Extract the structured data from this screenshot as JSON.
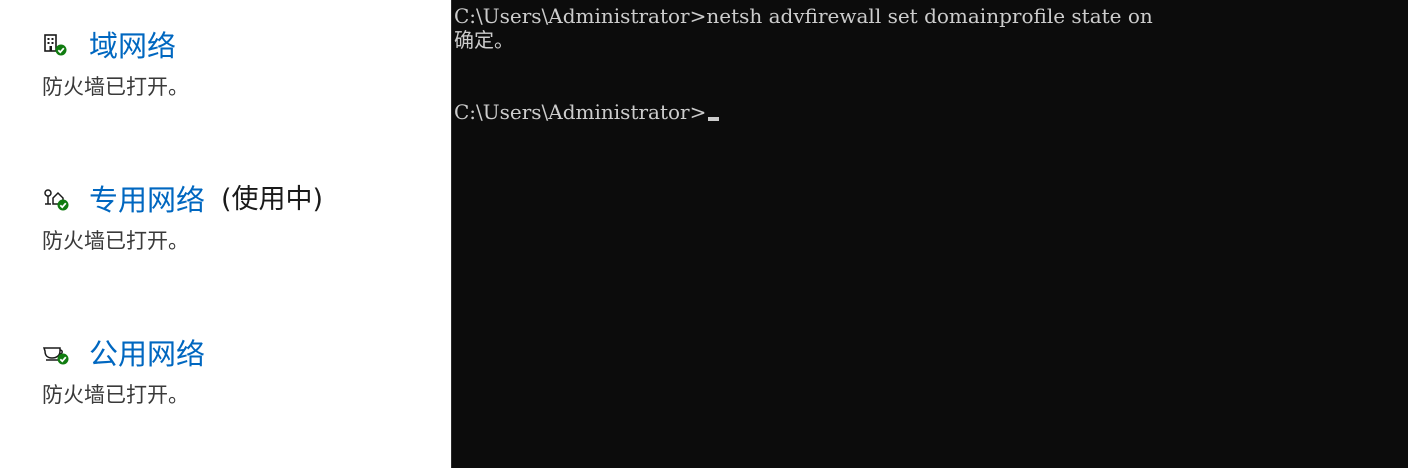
{
  "firewall": {
    "networks": [
      {
        "name": "域网络",
        "icon": "domain-network-icon",
        "status": "防火墙已打开。",
        "in_use": ""
      },
      {
        "name": "专用网络",
        "icon": "private-network-icon",
        "status": "防火墙已打开。",
        "in_use": "(使用中)"
      },
      {
        "name": "公用网络",
        "icon": "public-network-icon",
        "status": "防火墙已打开。",
        "in_use": ""
      }
    ],
    "colors": {
      "link": "#0067c0",
      "status_check": "#107c10"
    }
  },
  "console": {
    "lines": [
      "C:\\Users\\Administrator>netsh advfirewall set domainprofile state on",
      "确定。",
      "",
      "C:\\Users\\Administrator>"
    ],
    "colors": {
      "background": "#0c0c0c",
      "text": "#cccccc"
    }
  }
}
